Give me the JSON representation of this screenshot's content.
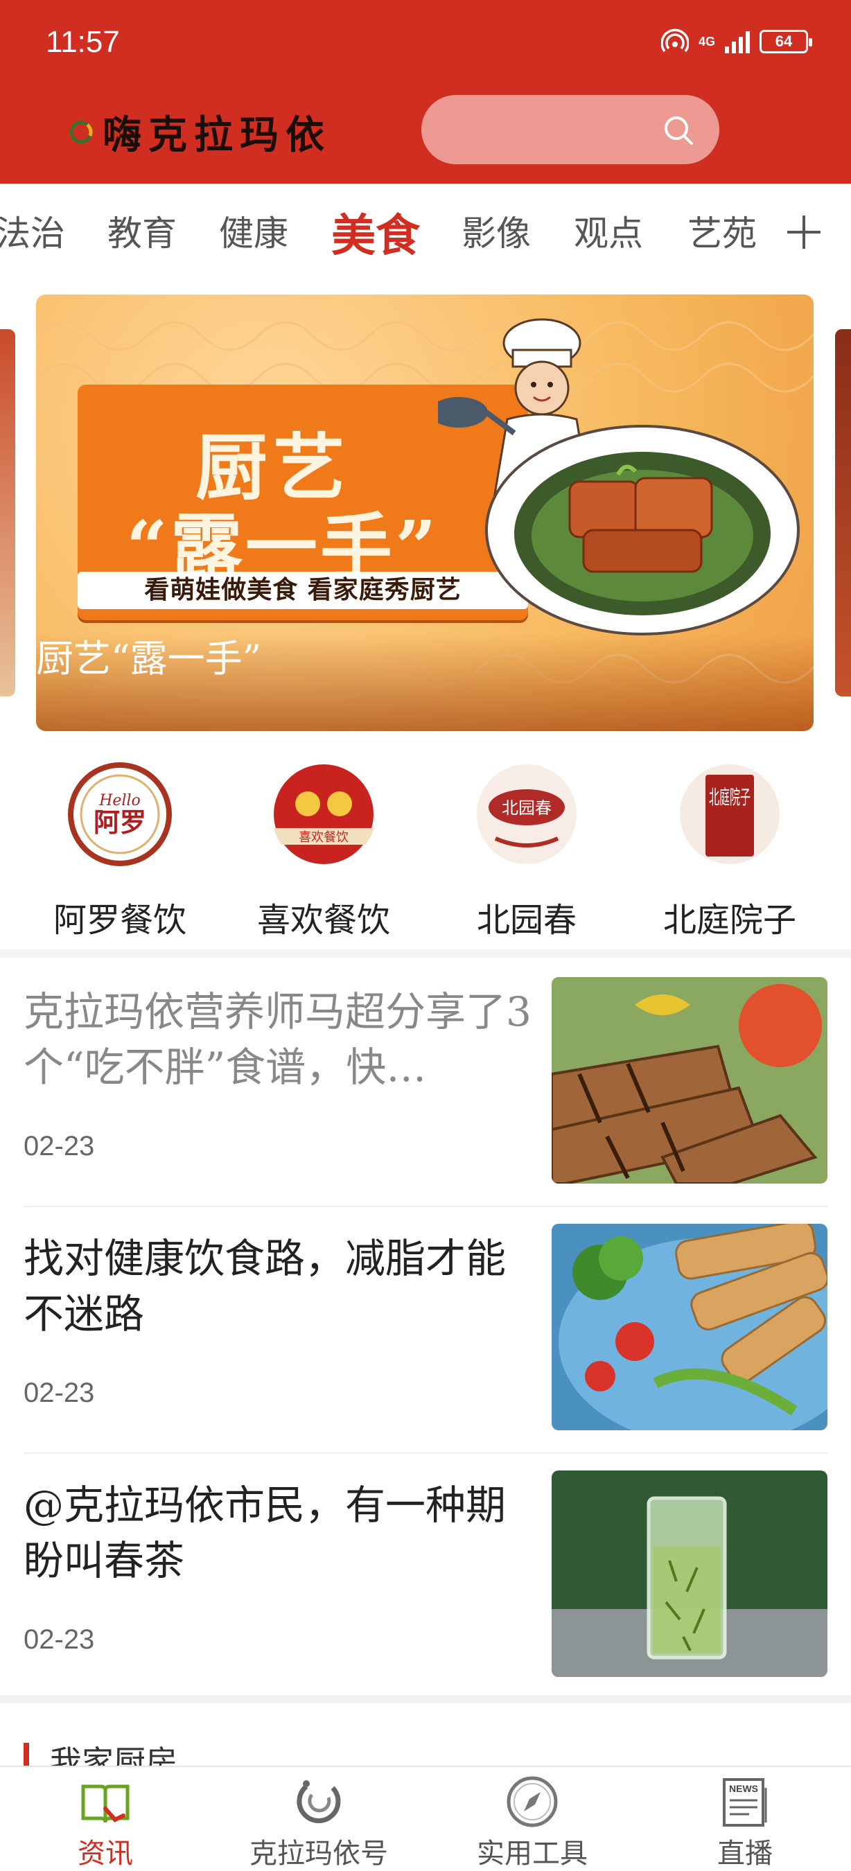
{
  "status_bar": {
    "time": "11:57",
    "network": "4G",
    "battery": "64"
  },
  "header": {
    "app_name": "嗨克拉玛依",
    "search_placeholder": ""
  },
  "tabs": [
    "法治",
    "教育",
    "健康",
    "美食",
    "影像",
    "观点",
    "艺苑"
  ],
  "active_tab": "美食",
  "banner": {
    "caption": "厨艺“露一手”",
    "promo_line1": "厨艺",
    "promo_line2": "“露一手”",
    "promo_strip": "看萌娃做美食 看家庭秀厨艺"
  },
  "restaurants": [
    {
      "name": "阿罗餐饮",
      "logo_text": "阿罗",
      "logo_sub": "Hello"
    },
    {
      "name": "喜欢餐饮",
      "logo_text": "喜欢餐饮"
    },
    {
      "name": "北园春",
      "logo_text": "北园春"
    },
    {
      "name": "北庭院子",
      "logo_text": "北庭院子"
    }
  ],
  "news": [
    {
      "title": "克拉玛依营养师马超分享了3个“吃不胖”食谱，快…",
      "date": "02-23",
      "read": true
    },
    {
      "title": "找对健康饮食路，减脂才能不迷路",
      "date": "02-23",
      "read": false
    },
    {
      "title": "@克拉玛依市民，有一种期盼叫春茶",
      "date": "02-23",
      "read": false
    }
  ],
  "section": {
    "title": "我家厨房"
  },
  "bottom_nav": [
    {
      "label": "资讯",
      "icon": "book-icon",
      "active": true
    },
    {
      "label": "克拉玛依号",
      "icon": "swirl-icon",
      "active": false
    },
    {
      "label": "实用工具",
      "icon": "compass-icon",
      "active": false
    },
    {
      "label": "直播",
      "icon": "news-icon",
      "active": false
    }
  ],
  "colors": {
    "brand_red": "#d12e22",
    "search_bg": "#ec9a92"
  }
}
